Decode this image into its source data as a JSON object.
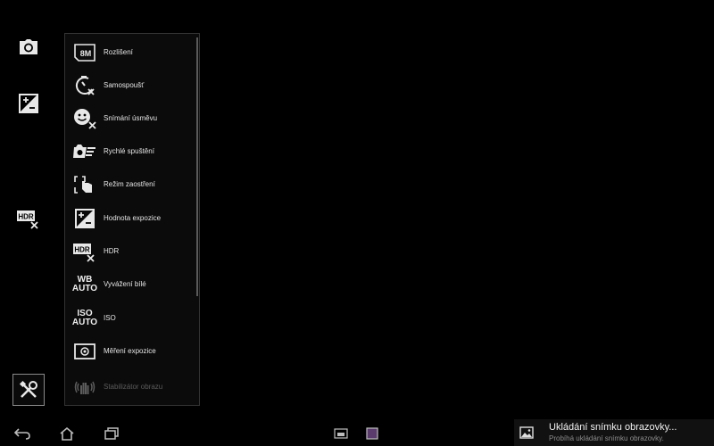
{
  "left_rail": {
    "camera_icon": "camera-icon",
    "exposure_icon": "exposure-icon",
    "hdr_icon": "hdr-off-icon",
    "settings_icon": "tools-icon"
  },
  "settings_menu": {
    "items": [
      {
        "label": "Rozlišení",
        "icon": "resolution-8m-icon"
      },
      {
        "label": "Samospoušť",
        "icon": "self-timer-off-icon"
      },
      {
        "label": "Snímání úsměvu",
        "icon": "smile-shutter-off-icon"
      },
      {
        "label": "Rychlé spuštění",
        "icon": "quick-launch-icon"
      },
      {
        "label": "Režim zaostření",
        "icon": "touch-focus-icon"
      },
      {
        "label": "Hodnota expozice",
        "icon": "exposure-value-icon"
      },
      {
        "label": "HDR",
        "icon": "hdr-off-icon"
      },
      {
        "label": "Vyvážení bílé",
        "icon": "white-balance-auto-icon"
      },
      {
        "label": "ISO",
        "icon": "iso-auto-icon"
      },
      {
        "label": "Měření expozice",
        "icon": "metering-icon"
      },
      {
        "label": "Stabilizátor obrazu",
        "icon": "stabilizer-icon"
      }
    ],
    "icon_text": {
      "resolution": "8M",
      "hdr": "HDR",
      "wb_top": "WB",
      "wb_bottom": "AUTO",
      "iso_top": "ISO",
      "iso_bottom": "AUTO"
    }
  },
  "navbar": {
    "back_icon": "back-icon",
    "home_icon": "home-icon",
    "recents_icon": "recent-apps-icon"
  },
  "notification": {
    "title": "Ukládání snímku obrazovky...",
    "subtitle": "Probíhá ukládání snímku obrazovky."
  }
}
